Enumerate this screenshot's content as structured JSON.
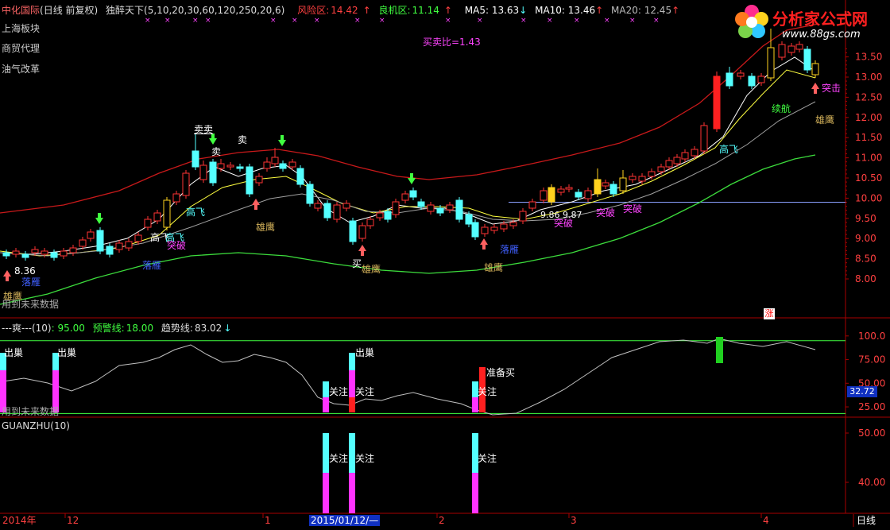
{
  "header": {
    "stock": "中化国际",
    "period": "(日线 前复权)",
    "indicator": "独醉天下",
    "params": "(5,10,20,30,60,120,250,20,6)",
    "risk_label": "风险区:",
    "risk_value": "14.42",
    "good_label": "良机区:",
    "good_value": "11.14",
    "ma5": "MA5: 13.63",
    "ma10": "MA10: 13.46",
    "ma20": "MA20: 12.45"
  },
  "sectors": [
    "上海板块",
    "商贸代理",
    "油气改革"
  ],
  "logo": {
    "title": "分析家公式网",
    "url": "www.88gs.com"
  },
  "ratio_text": "买卖比=1.43",
  "main_labels": {
    "sell1": "卖卖",
    "sell2": "卖",
    "sell3": "卖",
    "gaofei1": "高飞",
    "gaofei2": "高飞",
    "gaofei3": "高飞",
    "gaofei4": "高飞",
    "tupo1": "突破",
    "tupo2": "突破",
    "tupo3": "突破",
    "tupo4": "突破",
    "yaoying": "雄鹰",
    "yaoying2": "雄鹰",
    "yaoying3": "雄鹰",
    "yaoying4": "雄鹰",
    "yaoying5": "雄鹰",
    "luoyan1": "落雁",
    "luoyan2": "落雁",
    "luoyan3": "落雁",
    "buy": "买",
    "xuhang": "续航",
    "tuji": "突击",
    "price_low": "8.36",
    "range_left": "9.86",
    "range_right": "9.87",
    "future_note": "用到未来数据",
    "zhang": "涨"
  },
  "y_axis_main": [
    "13.50",
    "13.00",
    "12.50",
    "12.00",
    "11.50",
    "11.00",
    "10.50",
    "10.00",
    "9.50",
    "9.00",
    "8.50",
    "8.00"
  ],
  "sub1": {
    "title": "---爽---(10)",
    "v1": ": 95.00",
    "warn_label": "预警线:",
    "warn_value": "18.00",
    "trend_label": "趋势线:",
    "trend_value": "83.02",
    "ticks": [
      "100.0",
      "75.00",
      "50.00",
      "25.00"
    ],
    "current": "32.72",
    "chuchao": "出巢",
    "guanzhu": "关注",
    "zhunbei": "准备买",
    "future_note": "用到未来数据"
  },
  "sub2": {
    "title": "GUANZHU(10)",
    "ticks": [
      "50.00",
      "40.00",
      "30.00"
    ],
    "guanzhu": "关注"
  },
  "time_axis": {
    "labels": [
      "2014年",
      "12",
      "1",
      "2015/01/12/—",
      "2",
      "3",
      "4"
    ],
    "period_button": "日线"
  },
  "colors": {
    "up": "#ff3333",
    "down": "#54ffff",
    "red_line": "#c8191a",
    "green_line": "#3cdc3c",
    "magenta": "#ff33ff",
    "yellow": "#ffdc00",
    "frame": "#a80000"
  }
}
